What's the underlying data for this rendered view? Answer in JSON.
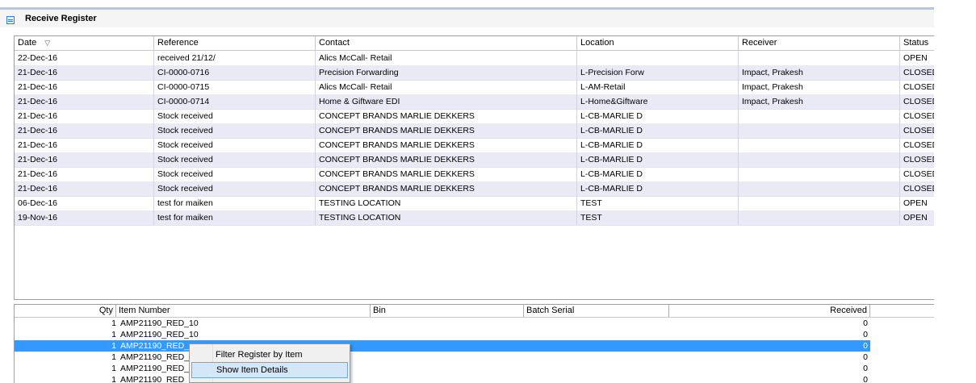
{
  "panel": {
    "title": "Receive Register"
  },
  "register": {
    "columns": [
      "Date",
      "Reference",
      "Contact",
      "Location",
      "Receiver",
      "Status"
    ],
    "sort_icon": "sort-desc-icon",
    "rows": [
      [
        "22-Dec-16",
        "received 21/12/",
        "Alics McCall- Retail",
        "",
        "",
        "OPEN"
      ],
      [
        "21-Dec-16",
        "CI-0000-0716",
        "Precision Forwarding",
        "L-Precision Forw",
        "Impact, Prakesh",
        "CLOSED"
      ],
      [
        "21-Dec-16",
        "CI-0000-0715",
        "Alics McCall- Retail",
        "L-AM-Retail",
        "Impact, Prakesh",
        "CLOSED"
      ],
      [
        "21-Dec-16",
        "CI-0000-0714",
        "Home & Giftware EDI",
        "L-Home&Giftware",
        "Impact, Prakesh",
        "CLOSED"
      ],
      [
        "21-Dec-16",
        "Stock received",
        "CONCEPT BRANDS MARLIE DEKKERS",
        "L-CB-MARLIE D",
        "",
        "CLOSED"
      ],
      [
        "21-Dec-16",
        "Stock received",
        "CONCEPT BRANDS MARLIE DEKKERS",
        "L-CB-MARLIE D",
        "",
        "CLOSED"
      ],
      [
        "21-Dec-16",
        "Stock received",
        "CONCEPT BRANDS MARLIE DEKKERS",
        "L-CB-MARLIE D",
        "",
        "CLOSED"
      ],
      [
        "21-Dec-16",
        "Stock received",
        "CONCEPT BRANDS MARLIE DEKKERS",
        "L-CB-MARLIE D",
        "",
        "CLOSED"
      ],
      [
        "21-Dec-16",
        "Stock received",
        "CONCEPT BRANDS MARLIE DEKKERS",
        "L-CB-MARLIE D",
        "",
        "CLOSED"
      ],
      [
        "21-Dec-16",
        "Stock received",
        "CONCEPT BRANDS MARLIE DEKKERS",
        "L-CB-MARLIE D",
        "",
        "CLOSED"
      ],
      [
        "06-Dec-16",
        "test for maiken",
        "TESTING LOCATION",
        "TEST",
        "",
        "OPEN"
      ],
      [
        "19-Nov-16",
        "test for maiken",
        "TESTING LOCATION",
        "TEST",
        "",
        "OPEN"
      ]
    ]
  },
  "items": {
    "columns": [
      "Qty",
      "Item Number",
      "Bin",
      "Batch Serial",
      "Received"
    ],
    "rows": [
      {
        "qty": "1",
        "item": "AMP21190_RED_10",
        "received": "0",
        "selected": false
      },
      {
        "qty": "1",
        "item": "AMP21190_RED_10",
        "received": "0",
        "selected": false
      },
      {
        "qty": "1",
        "item": "AMP21190_RED_",
        "received": "0",
        "selected": true
      },
      {
        "qty": "1",
        "item": "AMP21190_RED_",
        "received": "0",
        "selected": false
      },
      {
        "qty": "1",
        "item": "AMP21190_RED_",
        "received": "0",
        "selected": false
      },
      {
        "qty": "1",
        "item": "AMP21190_RED",
        "received": "0",
        "selected": false
      }
    ]
  },
  "context_menu": {
    "items": [
      "Filter Register by Item",
      "Show Item Details"
    ],
    "highlighted": "Show Item Details"
  },
  "colors": {
    "selection": "#3399ff",
    "alt_row": "#eaeaf6",
    "menu_highlight": "#d5e6f7"
  }
}
